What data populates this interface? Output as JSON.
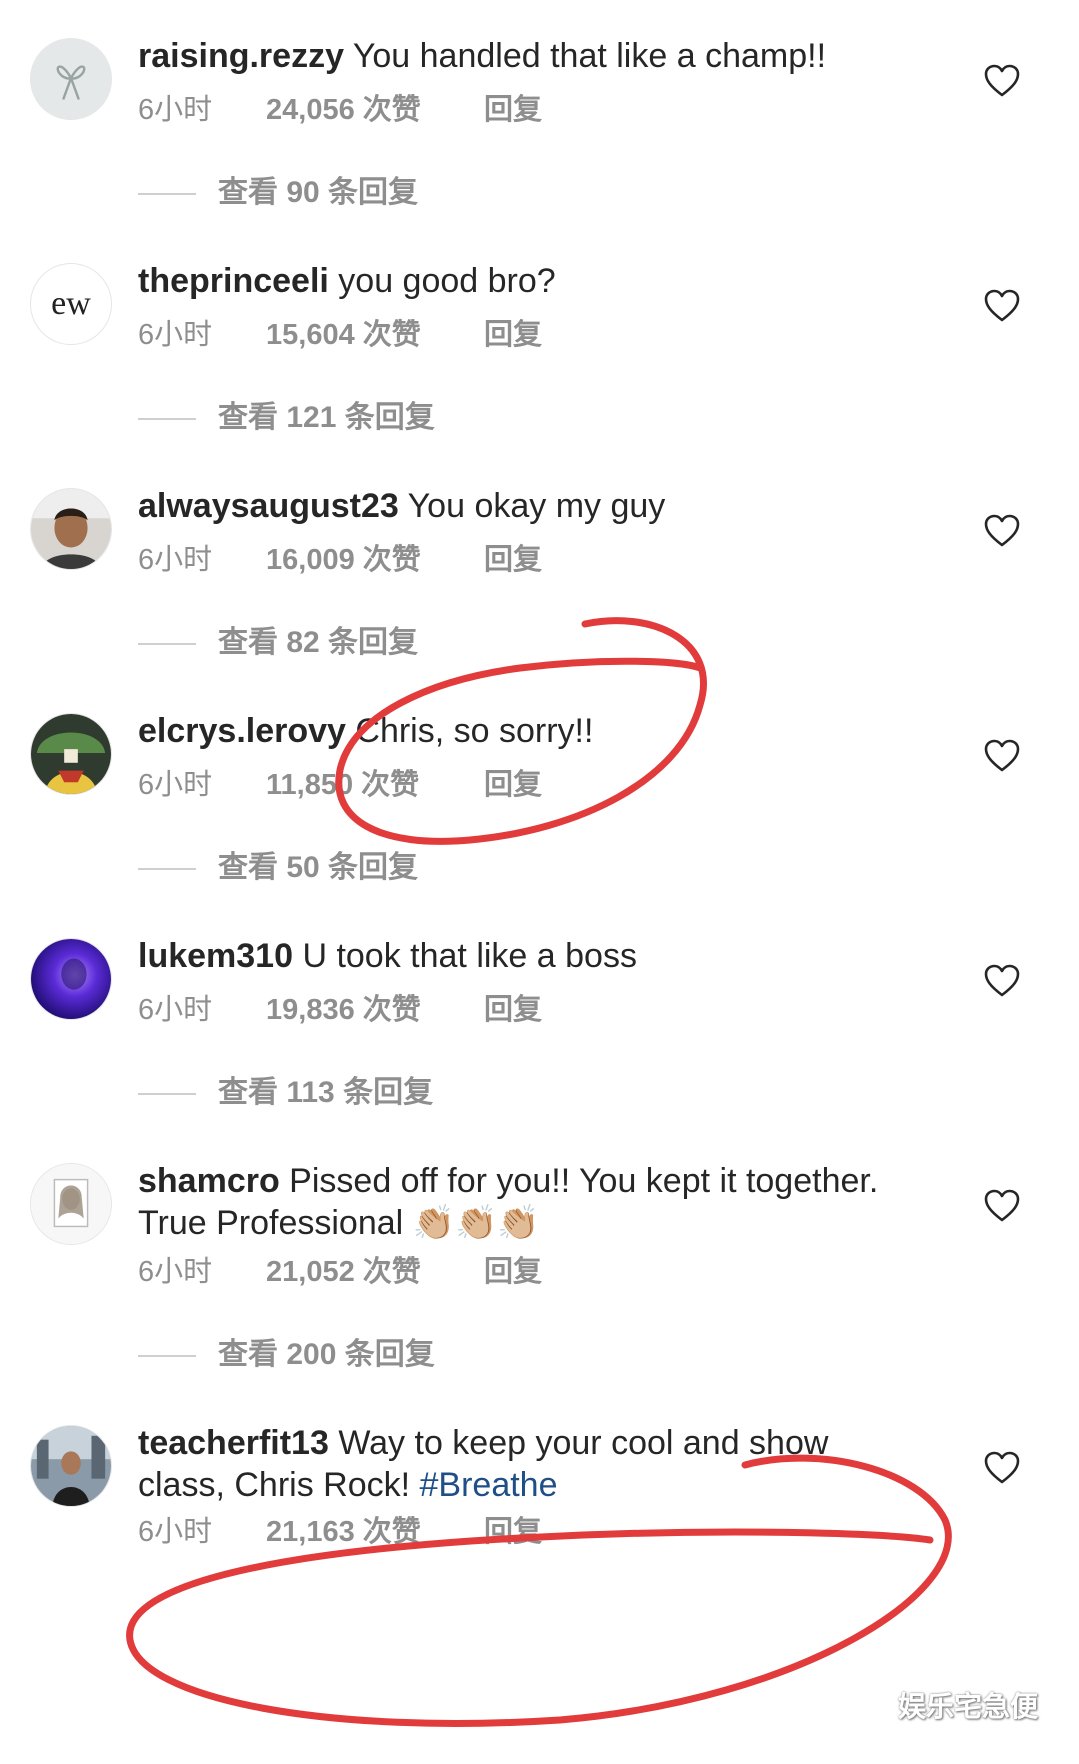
{
  "comments": [
    {
      "username": "raising.rezzy",
      "text": " You handled that like a champ!!",
      "time": "6小时",
      "likes": "24,056 次赞",
      "reply": "回复",
      "view_replies": "查看 90 条回复",
      "avatar": "ribbon-logo-avatar"
    },
    {
      "username": "theprinceeli",
      "text": " you good bro?",
      "time": "6小时",
      "likes": "15,604 次赞",
      "reply": "回复",
      "view_replies": "查看 121 条回复",
      "avatar": "ew-logo-avatar",
      "avatar_text": "ew"
    },
    {
      "username": "alwaysaugust23",
      "text": " You okay my guy",
      "time": "6小时",
      "likes": "16,009 次赞",
      "reply": "回复",
      "view_replies": "查看 82 条回复",
      "avatar": "person-photo-avatar"
    },
    {
      "username": "elcrys.lerovy",
      "text": " Chris, so sorry!!",
      "time": "6小时",
      "likes": "11,850 次赞",
      "reply": "回复",
      "view_replies": "查看 50 条回复",
      "avatar": "cartoon-avatar"
    },
    {
      "username": "lukem310",
      "text": " U took that like a boss",
      "time": "6小时",
      "likes": "19,836 次赞",
      "reply": "回复",
      "view_replies": "查看 113 条回复",
      "avatar": "purple-glow-avatar"
    },
    {
      "username": "shamcro",
      "text": " Pissed off for you!! You kept it together. True Professional 👏🏼👏🏼👏🏼",
      "time": "6小时",
      "likes": "21,052 次赞",
      "reply": "回复",
      "view_replies": "查看 200 条回复",
      "avatar": "portrait-sketch-avatar"
    },
    {
      "username": "teacherfit13",
      "text": " Way to keep your cool and show class, Chris Rock! ",
      "hashtag": "#Breathe",
      "time": "6小时",
      "likes": "21,163 次赞",
      "reply": "回复",
      "avatar": "outdoor-photo-avatar"
    }
  ],
  "watermark": "娱乐宅急便",
  "colors": {
    "text": "#262626",
    "meta": "#8e8e8e",
    "hashtag": "#1f4f86",
    "annotation": "#e23b3b"
  }
}
